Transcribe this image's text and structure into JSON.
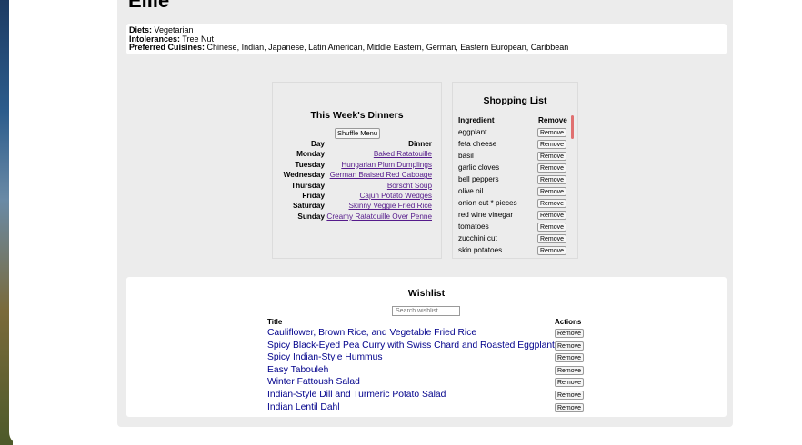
{
  "page": {
    "title": "Ellie",
    "preferences": {
      "diets_label": "Diets:",
      "diets_value": "Vegetarian",
      "intolerances_label": "Intolerances:",
      "intolerances_value": "Tree Nut",
      "cuisines_label": "Preferred Cuisines:",
      "cuisines_value": "Chinese, Indian, Japanese, Latin American, Middle Eastern, German, Eastern European, Caribbean"
    }
  },
  "dinners": {
    "heading": "This Week's Dinners",
    "shuffle_label": "Shuffle Menu",
    "header_day": "Day",
    "header_dinner": "Dinner",
    "rows": [
      {
        "day": "Monday",
        "dish": "Baked Ratatouille"
      },
      {
        "day": "Tuesday",
        "dish": "Hungarian Plum Dumplings"
      },
      {
        "day": "Wednesday",
        "dish": "German Braised Red Cabbage"
      },
      {
        "day": "Thursday",
        "dish": "Borscht Soup"
      },
      {
        "day": "Friday",
        "dish": "Cajun Potato Wedges"
      },
      {
        "day": "Saturday",
        "dish": "Skinny Veggie Fried Rice"
      },
      {
        "day": "Sunday",
        "dish": "Creamy Ratatouille Over Penne"
      }
    ]
  },
  "shopping": {
    "heading": "Shopping List",
    "header_ingredient": "Ingredient",
    "header_remove": "Remove",
    "remove_label": "Remove",
    "items": [
      "eggplant",
      "feta cheese",
      "basil",
      "garlic cloves",
      "bell peppers",
      "olive oil",
      "onion cut * pieces",
      "red wine vinegar",
      "tomatoes",
      "zucchini cut",
      "skin potatoes"
    ]
  },
  "wishlist": {
    "heading": "Wishlist",
    "search_placeholder": "Search wishlist...",
    "header_title": "Title",
    "header_actions": "Actions",
    "remove_label": "Remove",
    "items": [
      "Cauliflower, Brown Rice, and Vegetable Fried Rice",
      "Spicy Black-Eyed Pea Curry with Swiss Chard and Roasted Eggplant",
      "Spicy Indian-Style Hummus",
      "Easy Tabouleh",
      "Winter Fattoush Salad",
      "Indian-Style Dill and Turmeric Potato Salad",
      "Indian Lentil Dahl"
    ]
  }
}
